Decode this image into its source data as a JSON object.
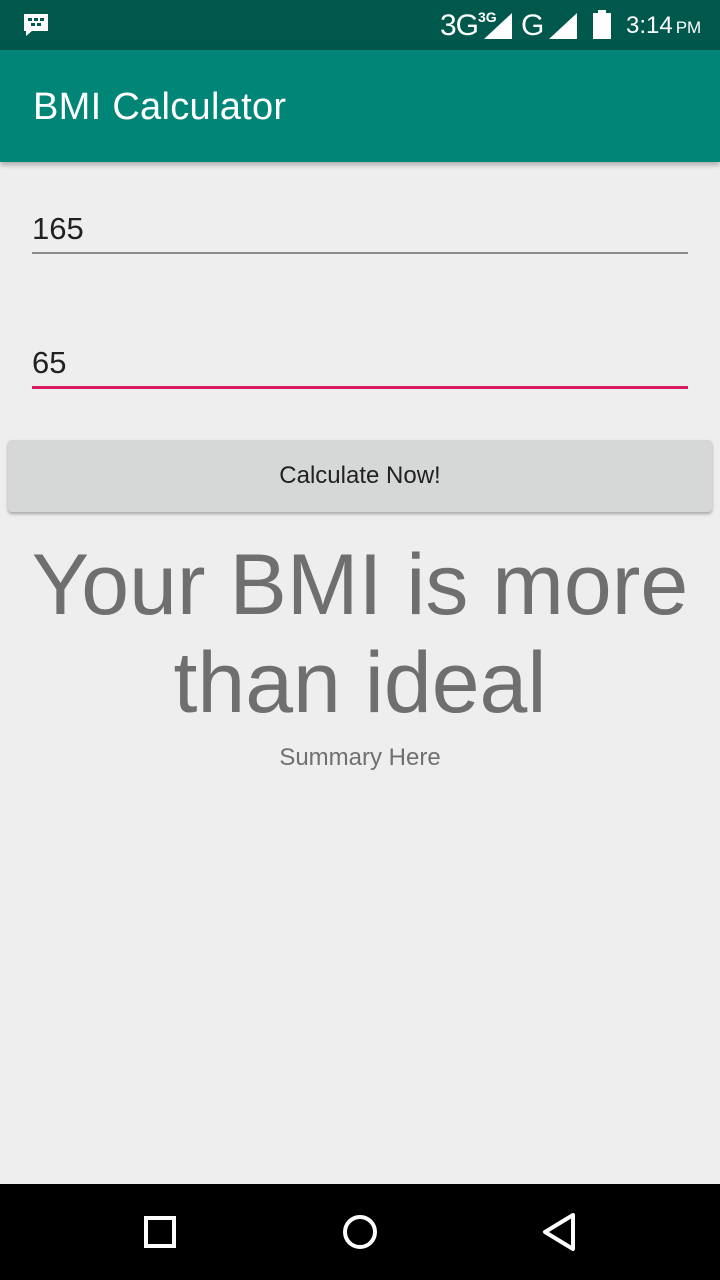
{
  "status_bar": {
    "network_primary": "3G",
    "network_primary_sup": "3G",
    "network_secondary": "G",
    "time": "3:14",
    "ampm": "PM",
    "icons": [
      "bbm-icon",
      "signal-icon",
      "signal-icon",
      "battery-icon"
    ]
  },
  "app_bar": {
    "title": "BMI Calculator",
    "color": "#008577"
  },
  "form": {
    "height_value": "165",
    "weight_value": "65",
    "accent_color": "#d81b60"
  },
  "button": {
    "label": "Calculate Now!"
  },
  "result": {
    "message": "Your BMI is more than ideal",
    "summary": "Summary Here"
  },
  "nav_bar": {
    "icons": [
      "recents-icon",
      "home-icon",
      "back-icon"
    ]
  }
}
